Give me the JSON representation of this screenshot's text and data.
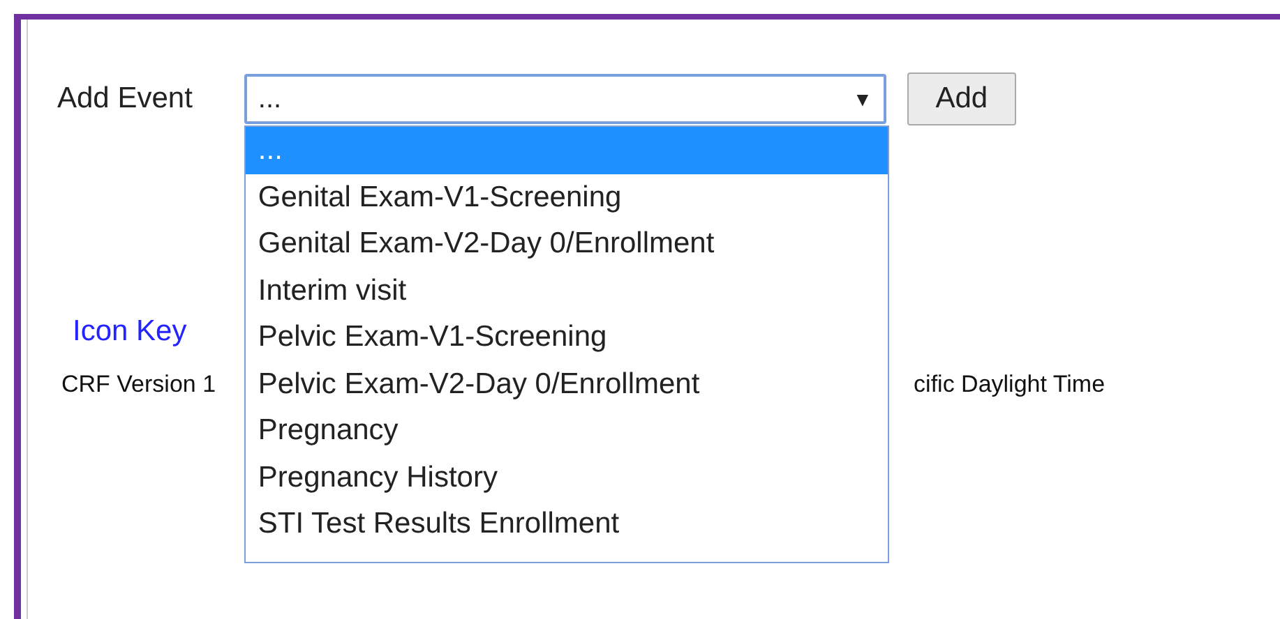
{
  "add_event": {
    "label": "Add Event",
    "select": {
      "value": "...",
      "expanded": true,
      "options": [
        {
          "label": "...",
          "selected": true
        },
        {
          "label": "Genital Exam-V1-Screening",
          "selected": false
        },
        {
          "label": "Genital Exam-V2-Day 0/Enrollment",
          "selected": false
        },
        {
          "label": "Interim visit",
          "selected": false
        },
        {
          "label": "Pelvic Exam-V1-Screening",
          "selected": false
        },
        {
          "label": "Pelvic Exam-V2-Day 0/Enrollment",
          "selected": false
        },
        {
          "label": "Pregnancy",
          "selected": false
        },
        {
          "label": "Pregnancy History",
          "selected": false
        },
        {
          "label": "STI Test Results Enrollment",
          "selected": false
        }
      ]
    },
    "caret": "▼",
    "button": "Add"
  },
  "icon_key": "Icon Key",
  "info_line": {
    "left": "CRF Version 1",
    "right": "cific Daylight Time"
  }
}
